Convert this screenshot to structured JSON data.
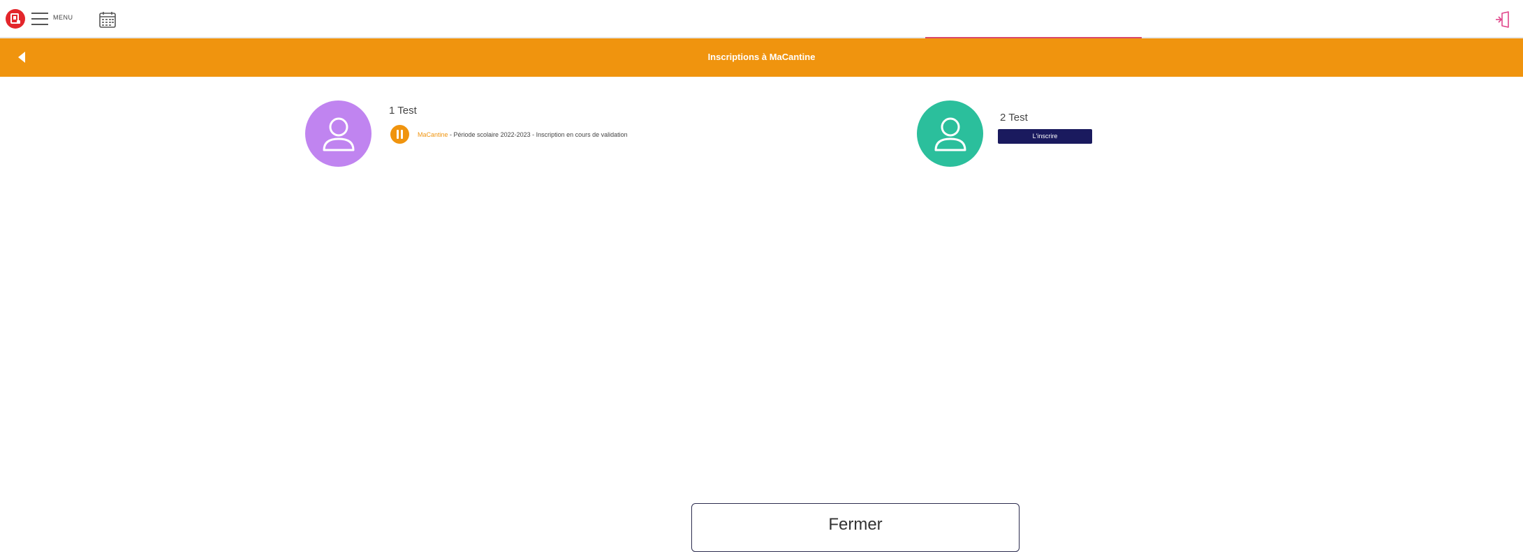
{
  "topbar": {
    "menu_label": "MENU",
    "icons": {
      "logo": "app-logo-icon",
      "menu": "hamburger-icon",
      "calendar": "calendar-icon",
      "logout": "logout-icon"
    }
  },
  "header": {
    "title": "Inscriptions à MaCantine",
    "background": "#f0940e"
  },
  "children": [
    {
      "name": "1 Test",
      "avatar_color": "#c084f0",
      "status": {
        "service": "MaCantine",
        "detail": " - Période scolaire 2022-2023 - Inscription en cours de validation",
        "icon": "pause-icon"
      }
    },
    {
      "name": "2 Test",
      "avatar_color": "#2bbf9c",
      "button_label": "L'inscrire"
    }
  ],
  "close_button": {
    "label": "Fermer"
  },
  "colors": {
    "accent": "#f0940e",
    "button_dark": "#1a1a5e",
    "logo_red": "#e3262b",
    "logout_pink": "#e0458a"
  }
}
